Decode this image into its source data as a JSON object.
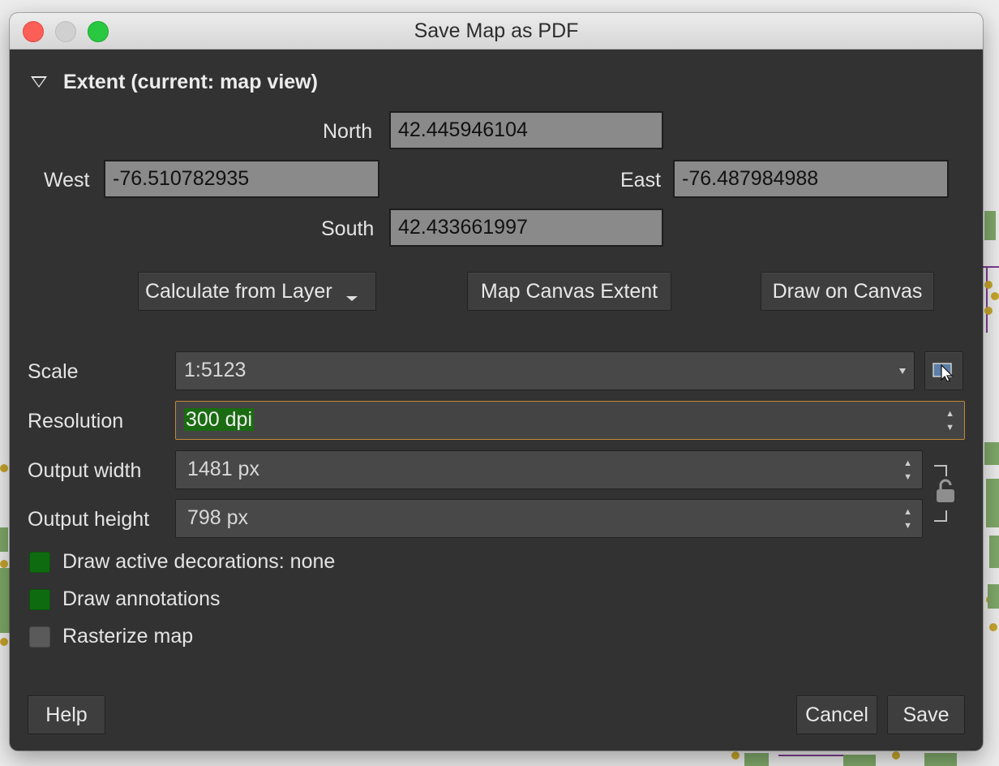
{
  "window": {
    "title": "Save Map as PDF"
  },
  "extent": {
    "title": "Extent (current: map view)",
    "north_label": "North",
    "north_value": "42.445946104",
    "west_label": "West",
    "west_value": "-76.510782935",
    "east_label": "East",
    "east_value": "-76.487984988",
    "south_label": "South",
    "south_value": "42.433661997",
    "calc_layer_label": "Calculate from Layer",
    "map_canvas_label": "Map Canvas Extent",
    "draw_canvas_label": "Draw on Canvas"
  },
  "scale": {
    "label": "Scale",
    "value": "1:5123"
  },
  "resolution": {
    "label": "Resolution",
    "value": "300 dpi"
  },
  "output_width": {
    "label": "Output width",
    "value": "1481 px"
  },
  "output_height": {
    "label": "Output height",
    "value": "798 px"
  },
  "options": {
    "draw_decorations": {
      "label": "Draw active decorations: none",
      "checked": true
    },
    "draw_annotations": {
      "label": "Draw annotations",
      "checked": true
    },
    "rasterize": {
      "label": "Rasterize map",
      "checked": false
    }
  },
  "footer": {
    "help_label": "Help",
    "cancel_label": "Cancel",
    "save_label": "Save"
  },
  "colors": {
    "accent_focus": "#c08a38",
    "selection": "#1a6b12",
    "checked": "#0f6b0f",
    "panel": "#323232"
  },
  "icons": {
    "collapse": "triangle-down-icon",
    "map-pick": "map-cursor-icon",
    "lock": "unlocked-padlock-icon"
  }
}
